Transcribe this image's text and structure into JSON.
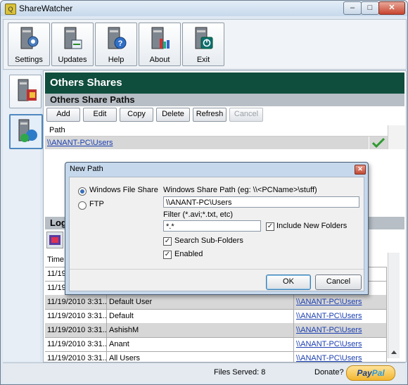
{
  "window": {
    "title": "ShareWatcher",
    "min": "–",
    "max": "□",
    "close": "✕"
  },
  "toolbar": [
    {
      "label": "Settings",
      "icon": "settings-icon"
    },
    {
      "label": "Updates",
      "icon": "updates-icon"
    },
    {
      "label": "Help",
      "icon": "help-icon"
    },
    {
      "label": "About",
      "icon": "about-icon"
    },
    {
      "label": "Exit",
      "icon": "exit-icon"
    }
  ],
  "main": {
    "title": "Others Shares",
    "subtitle": "Others Share Paths",
    "buttons": [
      "Add",
      "Edit",
      "Copy",
      "Delete",
      "Refresh",
      "Cancel"
    ],
    "path_header": "Path",
    "path_value": "\\\\ANANT-PC\\Users",
    "logs_header": "Log",
    "logs_col_time": "Time"
  },
  "logs": [
    {
      "time": "11/19",
      "user": "",
      "path": ""
    },
    {
      "time": "11/19",
      "user": "",
      "path": ""
    },
    {
      "time": "11/19/2010 3:31...",
      "user": "Default User",
      "path": "\\\\ANANT-PC\\Users"
    },
    {
      "time": "11/19/2010 3:31...",
      "user": "Default",
      "path": "\\\\ANANT-PC\\Users"
    },
    {
      "time": "11/19/2010 3:31...",
      "user": "AshishM",
      "path": "\\\\ANANT-PC\\Users"
    },
    {
      "time": "11/19/2010 3:31...",
      "user": "Anant",
      "path": "\\\\ANANT-PC\\Users"
    },
    {
      "time": "11/19/2010 3:31...",
      "user": "All Users",
      "path": "\\\\ANANT-PC\\Users"
    }
  ],
  "status": {
    "files_served": "Files Served: 8",
    "donate": "Donate?",
    "paypal_a": "Pay",
    "paypal_b": "Pal"
  },
  "dialog": {
    "title": "New Path",
    "opt_windows": "Windows File Share",
    "opt_ftp": "FTP",
    "share_label": "Windows Share Path (eg: \\\\<PCName>\\stuff)",
    "share_value": "\\\\ANANT-PC\\Users",
    "filter_label": "Filter (*.avi;*.txt, etc)",
    "filter_value": "*.*",
    "include_new": "Include New Folders",
    "search_sub": "Search Sub-Folders",
    "enabled": "Enabled",
    "ok": "OK",
    "cancel": "Cancel"
  }
}
